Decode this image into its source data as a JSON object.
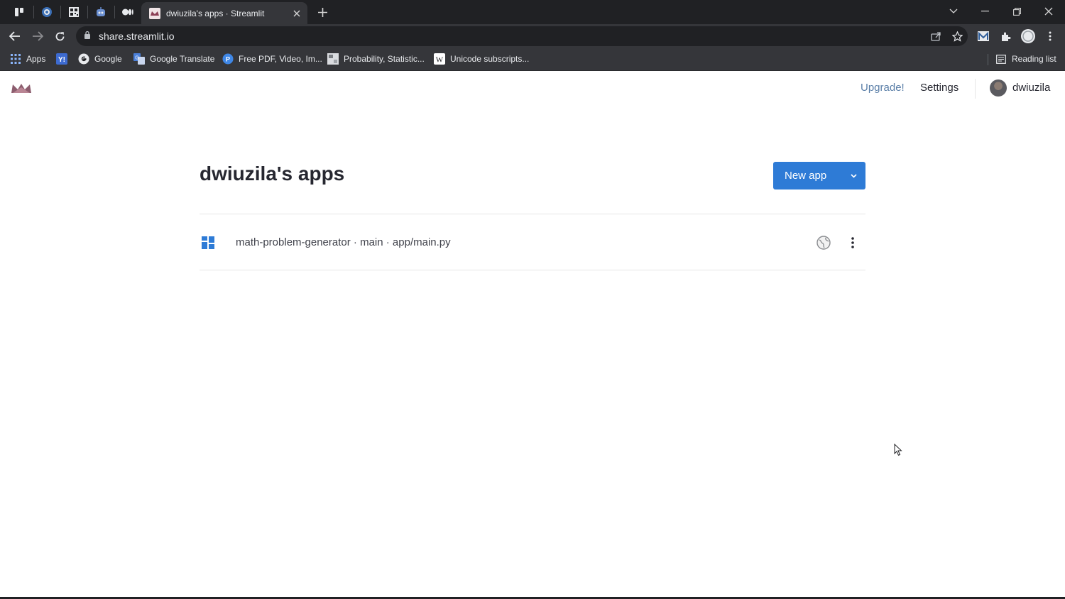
{
  "browser": {
    "active_tab_title": "dwiuzila's apps · Streamlit",
    "url": "share.streamlit.io",
    "pinned_tabs": [
      "trello-icon",
      "kemendikbud-icon",
      "qr-icon",
      "bot-icon",
      "medium-icon"
    ],
    "bookmarks": [
      {
        "label": "Apps",
        "icon": "apps-grid-icon"
      },
      {
        "label": "",
        "icon": "yahoo-icon"
      },
      {
        "label": "Google",
        "icon": "google-icon"
      },
      {
        "label": "Google Translate",
        "icon": "translate-icon"
      },
      {
        "label": "Free PDF, Video, Im...",
        "icon": "pdf-tool-icon"
      },
      {
        "label": "Probability, Statistic...",
        "icon": "probability-icon"
      },
      {
        "label": "Unicode subscripts...",
        "icon": "wikipedia-icon"
      }
    ],
    "reading_list": "Reading list"
  },
  "header": {
    "upgrade": "Upgrade!",
    "settings": "Settings",
    "username": "dwiuzila"
  },
  "main": {
    "title": "dwiuzila's apps",
    "new_app_label": "New app",
    "apps": [
      {
        "text": "math-problem-generator · main · app/main.py"
      }
    ]
  },
  "colors": {
    "accent": "#2e7bd6",
    "upgrade_link": "#5b7fa8",
    "chrome_dark": "#202124",
    "chrome_toolbar": "#35363a"
  }
}
